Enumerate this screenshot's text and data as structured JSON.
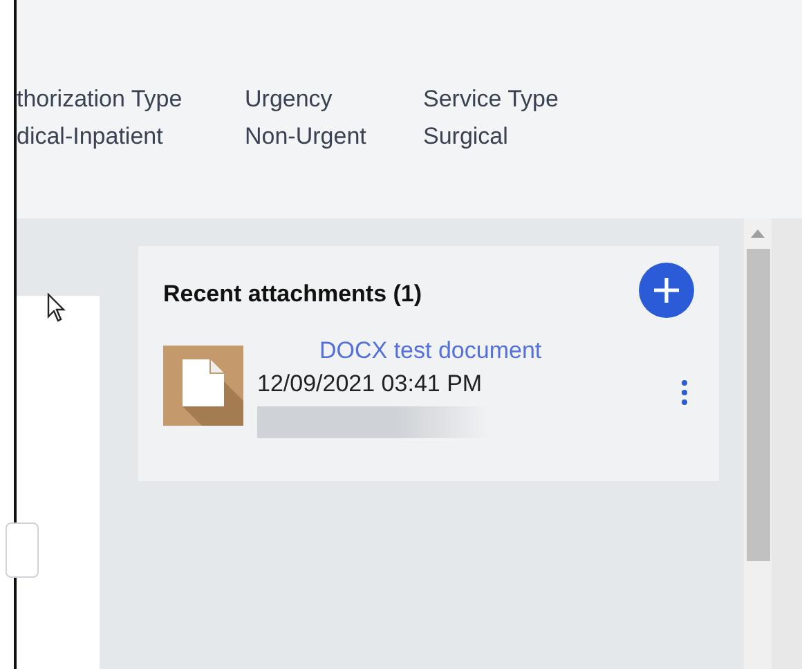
{
  "header_fields": [
    {
      "label": "thorization Type",
      "value": "dical-Inpatient"
    },
    {
      "label": "Urgency",
      "value": "Non-Urgent"
    },
    {
      "label": "Service Type",
      "value": "Surgical"
    }
  ],
  "attachments_card": {
    "title": "Recent attachments (1)",
    "items": [
      {
        "name": "DOCX test document",
        "timestamp": "12/09/2021 03:41 PM"
      }
    ]
  }
}
